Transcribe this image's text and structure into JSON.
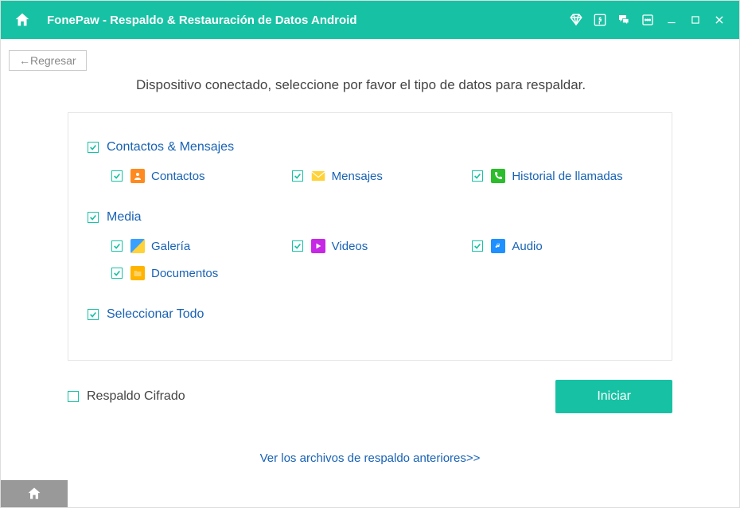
{
  "titlebar": {
    "title": "FonePaw -  Respaldo & Restauración de Datos Android"
  },
  "back": {
    "label": "Regresar"
  },
  "instruction": "Dispositivo conectado, seleccione por favor el tipo de datos para respaldar.",
  "groups": {
    "contacts_msgs": {
      "label": "Contactos & Mensajes"
    },
    "media": {
      "label": "Media"
    },
    "select_all": {
      "label": "Seleccionar Todo"
    }
  },
  "items": {
    "contacts": "Contactos",
    "messages": "Mensajes",
    "calls": "Historial de llamadas",
    "gallery": "Galería",
    "videos": "Videos",
    "audio": "Audio",
    "documents": "Documentos"
  },
  "encrypted": {
    "label": "Respaldo Cifrado"
  },
  "start": {
    "label": "Iniciar"
  },
  "prev_link": "Ver los archivos de respaldo anteriores>>"
}
